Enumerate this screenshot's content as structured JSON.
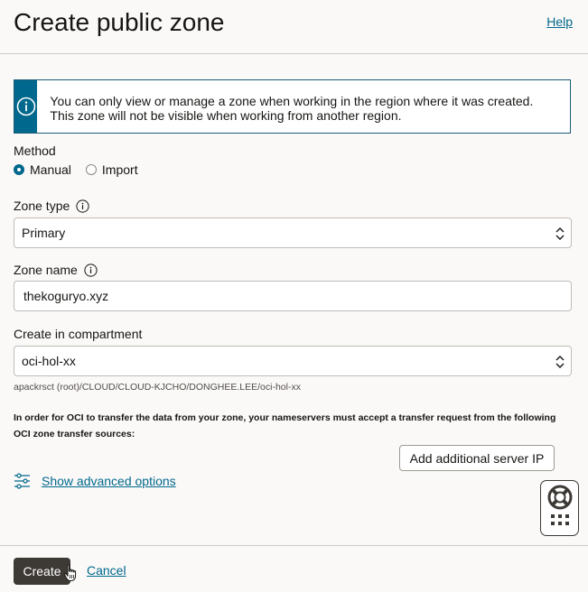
{
  "header": {
    "title": "Create public zone",
    "help_label": "Help"
  },
  "info_banner": {
    "text": "You can only view or manage a zone when working in the region where it was created. This zone will not be visible when working from another region."
  },
  "method": {
    "label": "Method",
    "options": [
      {
        "label": "Manual",
        "checked": true
      },
      {
        "label": "Import",
        "checked": false
      }
    ]
  },
  "zone_type": {
    "label": "Zone type",
    "value": "Primary"
  },
  "zone_name": {
    "label": "Zone name",
    "value": "thekoguryo.xyz"
  },
  "compartment": {
    "label": "Create in compartment",
    "value": "oci-hol-xx",
    "path": "apackrsct (root)/CLOUD/CLOUD-KJCHO/DONGHEE.LEE/oci-hol-xx"
  },
  "transfer_note": "In order for OCI to transfer the data from your zone, your nameservers must accept a transfer request from the following OCI zone transfer sources:",
  "add_server_ip_label": "Add additional server IP",
  "advanced_options_label": "Show advanced options",
  "footer": {
    "create_label": "Create",
    "cancel_label": "Cancel"
  },
  "icons": [
    "info-icon",
    "info-circle-icon",
    "chevrons-updown-icon",
    "sliders-icon",
    "lifebuoy-icon",
    "grid-dots-icon",
    "hand-cursor-icon"
  ],
  "colors": {
    "accent": "#00688c",
    "primary_button": "#3d3935",
    "background": "#fbf9f8"
  }
}
